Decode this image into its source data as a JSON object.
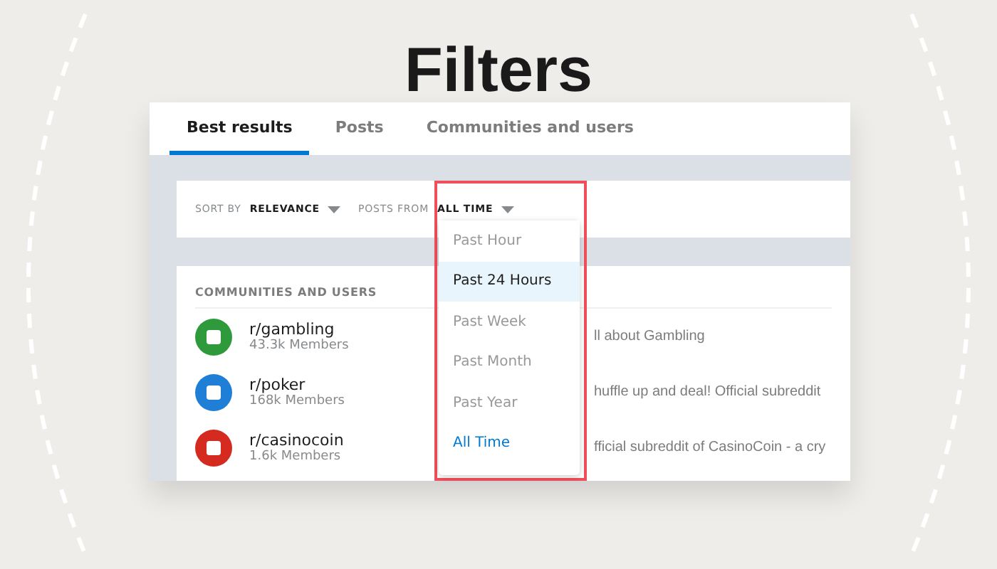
{
  "heading": "Filters",
  "tabs": [
    {
      "label": "Best results",
      "selected": true
    },
    {
      "label": "Posts",
      "selected": false
    },
    {
      "label": "Communities and users",
      "selected": false
    }
  ],
  "filters": [
    {
      "label": "SORT BY",
      "value": "RELEVANCE"
    },
    {
      "label": "POSTS FROM",
      "value": "ALL TIME"
    }
  ],
  "dropdown": [
    {
      "label": "Past Hour",
      "selected": false,
      "highlighted": false
    },
    {
      "label": "Past 24 Hours",
      "selected": false,
      "highlighted": true
    },
    {
      "label": "Past Week",
      "selected": false,
      "highlighted": false
    },
    {
      "label": "Past Month",
      "selected": false,
      "highlighted": false
    },
    {
      "label": "Past Year",
      "selected": false,
      "highlighted": false
    },
    {
      "label": "All Time",
      "selected": true,
      "highlighted": false
    }
  ],
  "communities": {
    "title": "COMMUNITIES AND USERS",
    "items": [
      {
        "name": "r/gambling",
        "members": "43.3k Members",
        "description": "ll about Gambling",
        "color": "#2e9a3c"
      },
      {
        "name": "r/poker",
        "members": "168k Members",
        "description": "huffle up and deal! Official subreddit",
        "color": "#1f7ed6"
      },
      {
        "name": "r/casinocoin",
        "members": "1.6k Members",
        "description": "fficial subreddit of CasinoCoin - a cry",
        "color": "#d42a20"
      }
    ]
  }
}
